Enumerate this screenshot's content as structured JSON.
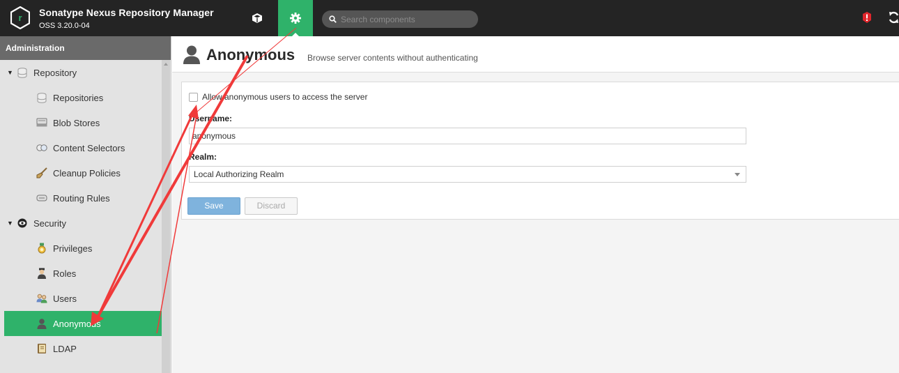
{
  "header": {
    "app_title": "Sonatype Nexus Repository Manager",
    "version": "OSS 3.20.0-04",
    "search_placeholder": "Search components"
  },
  "sidebar": {
    "title": "Administration",
    "items": [
      {
        "label": "Repository",
        "type": "group",
        "icon": "database-icon"
      },
      {
        "label": "Repositories",
        "type": "child",
        "icon": "database-icon"
      },
      {
        "label": "Blob Stores",
        "type": "child",
        "icon": "blob-store-icon"
      },
      {
        "label": "Content Selectors",
        "type": "child",
        "icon": "content-selector-icon"
      },
      {
        "label": "Cleanup Policies",
        "type": "child",
        "icon": "broom-icon"
      },
      {
        "label": "Routing Rules",
        "type": "child",
        "icon": "routing-icon"
      },
      {
        "label": "Security",
        "type": "group",
        "icon": "eye-icon"
      },
      {
        "label": "Privileges",
        "type": "child",
        "icon": "medal-icon"
      },
      {
        "label": "Roles",
        "type": "child",
        "icon": "role-icon"
      },
      {
        "label": "Users",
        "type": "child",
        "icon": "users-icon"
      },
      {
        "label": "Anonymous",
        "type": "child",
        "icon": "anonymous-icon",
        "active": true
      },
      {
        "label": "LDAP",
        "type": "child",
        "icon": "ldap-icon"
      }
    ]
  },
  "page": {
    "title": "Anonymous",
    "subtitle": "Browse server contents without authenticating"
  },
  "form": {
    "allow_anonymous_label": "Allow anonymous users to access the server",
    "allow_anonymous_checked": false,
    "username_label": "Username:",
    "username_value": "anonymous",
    "realm_label": "Realm:",
    "realm_value": "Local Authorizing Realm",
    "save_label": "Save",
    "discard_label": "Discard"
  },
  "colors": {
    "accent": "#2fb26a",
    "header_bg": "#242424",
    "annotation_arrow": "#f03a3a"
  }
}
